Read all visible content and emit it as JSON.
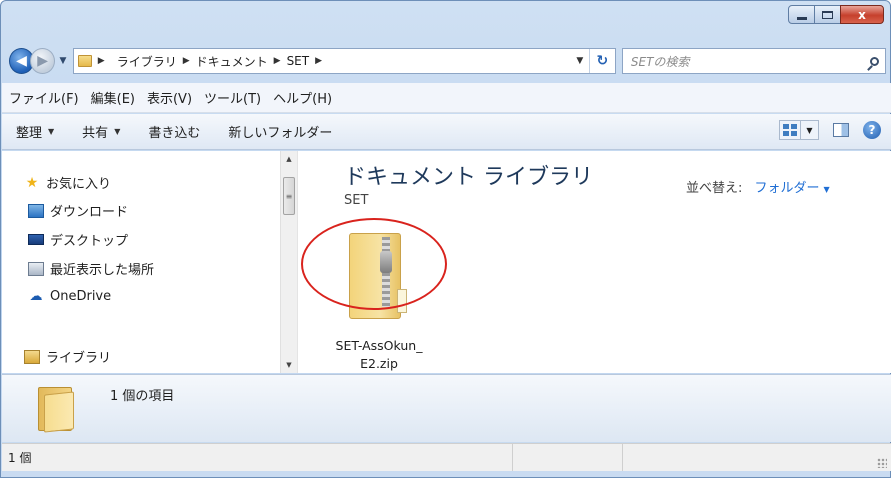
{
  "window": {
    "caption_buttons": {
      "minimize": "minimize",
      "maximize": "maximize",
      "close": "x"
    }
  },
  "address_bar": {
    "breadcrumbs": [
      "ライブラリ",
      "ドキュメント",
      "SET"
    ],
    "search_placeholder": "SETの検索"
  },
  "menu": {
    "items": [
      "ファイル(F)",
      "編集(E)",
      "表示(V)",
      "ツール(T)",
      "ヘルプ(H)"
    ]
  },
  "toolbar": {
    "organize": "整理",
    "share": "共有",
    "burn": "書き込む",
    "new_folder": "新しいフォルダー"
  },
  "nav_pane": {
    "favorites": "お気に入り",
    "downloads": "ダウンロード",
    "desktop": "デスクトップ",
    "recent": "最近表示した場所",
    "onedrive": "OneDrive",
    "libraries": "ライブラリ"
  },
  "content": {
    "title": "ドキュメント ライブラリ",
    "subtitle": "SET",
    "arrange_label": "並べ替え:",
    "arrange_value": "フォルダー",
    "files": [
      {
        "name": "SET-AssOkun_E2.zip",
        "icon": "zip-folder-icon"
      }
    ]
  },
  "details_pane": {
    "count_text": "1 個の項目"
  },
  "status_bar": {
    "text": "1 個"
  },
  "colors": {
    "title_text": "#1e395b",
    "accent_link": "#1f6ed4",
    "highlight_circle": "#d9231d"
  }
}
